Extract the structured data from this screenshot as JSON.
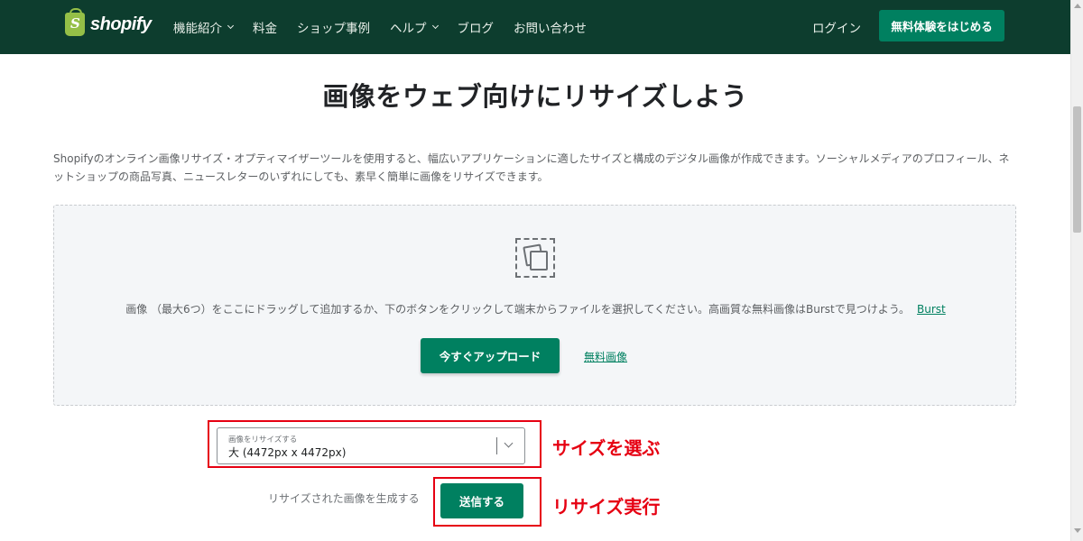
{
  "header": {
    "logo_text": "shopify",
    "logo_mark": "S",
    "nav": [
      {
        "label": "機能紹介",
        "dropdown": true
      },
      {
        "label": "料金",
        "dropdown": false
      },
      {
        "label": "ショップ事例",
        "dropdown": false
      },
      {
        "label": "ヘルプ",
        "dropdown": true
      },
      {
        "label": "ブログ",
        "dropdown": false
      },
      {
        "label": "お問い合わせ",
        "dropdown": false
      }
    ],
    "login_label": "ログイン",
    "trial_label": "無料体験をはじめる"
  },
  "main": {
    "title": "画像をウェブ向けにリサイズしよう",
    "intro": "Shopifyのオンライン画像リサイズ・オプティマイザーツールを使用すると、幅広いアプリケーションに適したサイズと構成のデジタル画像が作成できます。ソーシャルメディアのプロフィール、ネットショップの商品写真、ニュースレターのいずれにしても、素早く簡単に画像をリサイズできます。",
    "dropzone": {
      "icon": "photos-icon",
      "text": "画像 （最大6つ）をここにドラッグして追加するか、下のボタンをクリックして端末からファイルを選択してください。高画質な無料画像はBurstで見つけよう。",
      "burst_link": "Burst",
      "upload_label": "今すぐアップロード",
      "free_images_label": "無料画像"
    },
    "resize_select": {
      "label": "画像をリサイズする",
      "value": "大 (4472px x 4472px)"
    },
    "generate_label": "リサイズされた画像を生成する",
    "submit_label": "送信する"
  },
  "annotations": {
    "choose_size": "サイズを選ぶ",
    "run_resize": "リサイズ実行",
    "color": "#e60012"
  },
  "colors": {
    "header_bg": "#0d3d2e",
    "accent": "#008060"
  }
}
